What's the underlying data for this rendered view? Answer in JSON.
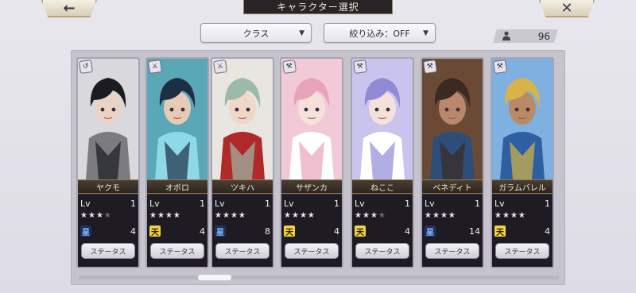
{
  "header": {
    "back_icon": "←",
    "title": "キャラクター選択",
    "close_icon": "✕"
  },
  "filters": {
    "class_dropdown": "クラス",
    "filter_dropdown": "絞り込み：OFF",
    "caret": "▼"
  },
  "owned_count": "96",
  "colors": {
    "card_frame": "#a9a4b3",
    "name_plate": "#3b3128",
    "rank_blue": "#7fb6ff",
    "rank_gold": "#f1d14a"
  },
  "status_label": "ステータス",
  "lv_label": "Lv",
  "characters": [
    {
      "name": "ヤクモ",
      "level": "1",
      "stars": 3,
      "max_stars": 4,
      "rank_icon": "星",
      "rank_type": "blue",
      "count": "4",
      "class_icon": "swirl-icon",
      "palette": [
        "#d9d8dc",
        "#1b1b22",
        "#e9d3c5",
        "#7b7b80"
      ]
    },
    {
      "name": "オボロ",
      "level": "1",
      "stars": 4,
      "max_stars": 4,
      "rank_icon": "天",
      "rank_type": "gold",
      "count": "4",
      "class_icon": "sword-icon",
      "palette": [
        "#5aa7b7",
        "#1d2f45",
        "#e6cab6",
        "#8fd8e8"
      ]
    },
    {
      "name": "ツキハ",
      "level": "1",
      "stars": 4,
      "max_stars": 4,
      "rank_icon": "星",
      "rank_type": "blue",
      "count": "8",
      "class_icon": "sword-icon",
      "palette": [
        "#e9e6e2",
        "#9db9a9",
        "#f0d8c9",
        "#b02a2a"
      ]
    },
    {
      "name": "サザンカ",
      "level": "1",
      "stars": 4,
      "max_stars": 4,
      "rank_icon": "天",
      "rank_type": "gold",
      "count": "4",
      "class_icon": "axe-icon",
      "palette": [
        "#f2c9d6",
        "#e8a3bb",
        "#f6e1da",
        "#ffffff"
      ]
    },
    {
      "name": "ねここ",
      "level": "1",
      "stars": 3,
      "max_stars": 4,
      "rank_icon": "天",
      "rank_type": "gold",
      "count": "4",
      "class_icon": "axe-icon",
      "palette": [
        "#c9c4ee",
        "#8f8bd6",
        "#f6e1da",
        "#ffffff"
      ]
    },
    {
      "name": "ベネディト",
      "level": "1",
      "stars": 4,
      "max_stars": 4,
      "rank_icon": "星",
      "rank_type": "blue",
      "count": "14",
      "class_icon": "axe-icon",
      "palette": [
        "#6b4a35",
        "#3a2a22",
        "#b9886b",
        "#2f4d7a"
      ]
    },
    {
      "name": "ガラムバレル",
      "level": "1",
      "stars": 4,
      "max_stars": 4,
      "rank_icon": "天",
      "rank_type": "gold",
      "count": "4",
      "class_icon": "axe-icon",
      "palette": [
        "#7fb1e0",
        "#d9b347",
        "#b98a63",
        "#2e5fa0"
      ]
    }
  ]
}
